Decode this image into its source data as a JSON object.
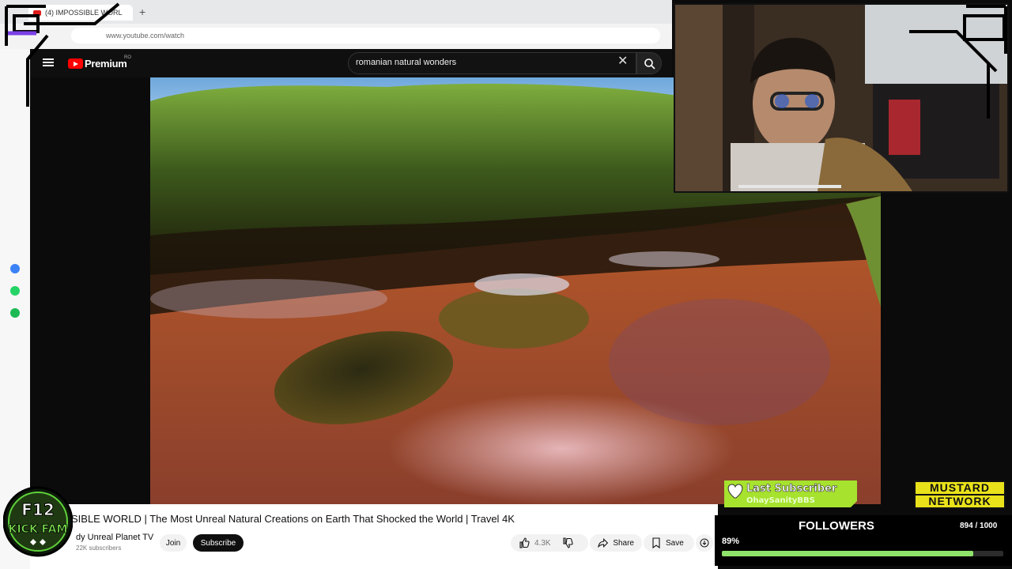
{
  "browser": {
    "tab_title": "(4) IMPOSSIBLE WORL",
    "new_tab": "+",
    "url": "www.youtube.com/watch"
  },
  "youtube": {
    "logo_text": "Premium",
    "country_code": "RO",
    "search_query": "romanian natural wonders",
    "clear_glyph": "✕"
  },
  "video": {
    "title": "SIBLE WORLD | The Most Unreal Natural Creations on Earth That Shocked the World | Travel 4K",
    "channel": "dy Unreal Planet TV",
    "subscribers": "22K subscribers",
    "join_label": "Join",
    "subscribe_label": "Subscribe",
    "likes": "4.3K",
    "share_label": "Share",
    "save_label": "Save"
  },
  "overlays": {
    "logo_line1": "F12",
    "logo_line2": "KICK FAM",
    "last_sub_label": "Last Subscriber",
    "last_sub_name": "OhaySanityBBS",
    "network_line1": "MUSTARD",
    "network_line2": "NETWORK",
    "followers_title": "FOLLOWERS",
    "followers_count": "894 / 1000",
    "followers_percent": "89%",
    "followers_fraction": 0.894
  },
  "colors": {
    "yt_red": "#ff0000",
    "progress_green": "#8fe36a",
    "sub_badge_green": "#a6e22e",
    "mustard_yellow": "#e9e21a"
  },
  "icons": [
    "menu-icon",
    "youtube-logo-icon",
    "search-icon",
    "clear-icon",
    "like-icon",
    "dislike-icon",
    "share-icon",
    "save-icon",
    "heart-icon",
    "messenger-icon",
    "whatsapp-icon",
    "spotify-icon"
  ]
}
